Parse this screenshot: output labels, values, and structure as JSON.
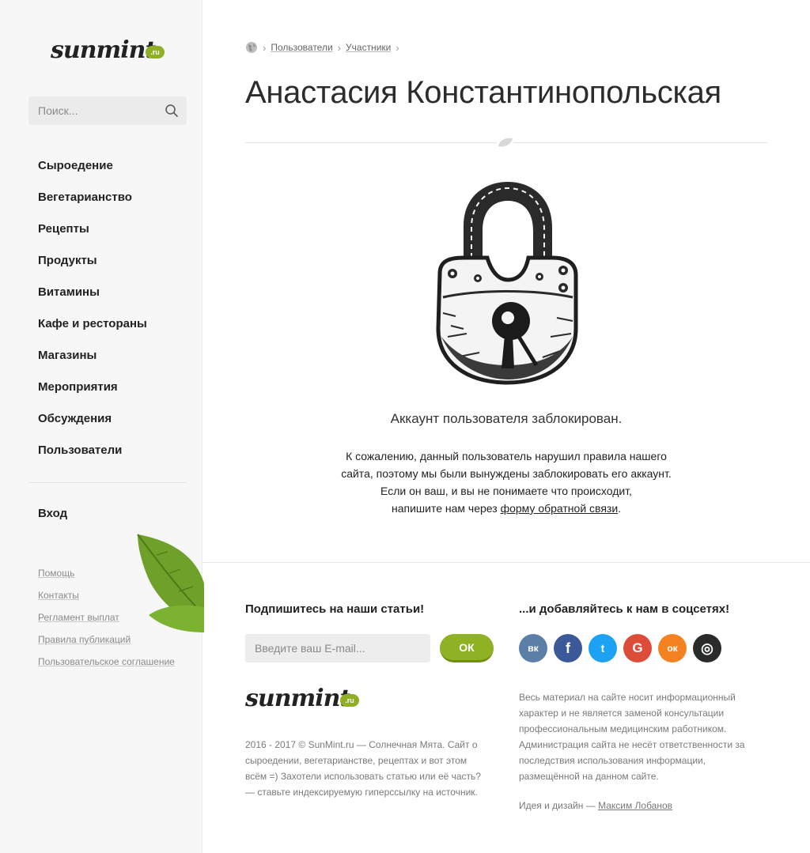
{
  "sidebar": {
    "logo_text": "sunmint",
    "logo_badge": ".ru",
    "search_placeholder": "Поиск...",
    "nav": [
      {
        "label": "Сыроедение"
      },
      {
        "label": "Вегетарианство"
      },
      {
        "label": "Рецепты"
      },
      {
        "label": "Продукты"
      },
      {
        "label": "Витамины"
      },
      {
        "label": "Кафе и рестораны"
      },
      {
        "label": "Магазины"
      },
      {
        "label": "Мероприятия"
      },
      {
        "label": "Обсуждения"
      },
      {
        "label": "Пользователи"
      }
    ],
    "login_label": "Вход",
    "small_links": [
      {
        "label": "Помощь"
      },
      {
        "label": "Контакты"
      },
      {
        "label": "Регламент выплат"
      },
      {
        "label": "Правила публикаций"
      },
      {
        "label": "Пользовательское соглашение"
      }
    ]
  },
  "breadcrumb": {
    "items": [
      {
        "label": "Пользователи"
      },
      {
        "label": "Участники"
      }
    ]
  },
  "page": {
    "title": "Анастасия Константинопольская",
    "blocked_title": "Аккаунт пользователя заблокирован.",
    "blocked_lines": [
      "К сожалению, данный пользователь нарушил правила нашего",
      "сайта, поэтому мы были вынуждены заблокировать его аккаунт.",
      "Если он ваш, и вы не понимаете что происходит,"
    ],
    "blocked_last_prefix": "напишите нам через ",
    "blocked_link": "форму обратной связи",
    "blocked_last_suffix": "."
  },
  "footer": {
    "subscribe_title": "Подпишитесь на наши статьи!",
    "email_placeholder": "Введите ваш E-mail...",
    "ok_label": "ОК",
    "logo_text": "sunmint",
    "logo_badge": ".ru",
    "copyright": "2016 - 2017 © SunMint.ru — Солнечная Мята. Сайт о сыроедении, вегетарианстве, рецептах и вот этом всём =) Захотели использовать статью или её часть? — ставьте индексируемую гиперссылку на источник.",
    "social_title": "...и добавляйтесь к нам в соцсетях!",
    "socials": [
      {
        "name": "vk-icon",
        "glyph": "вк",
        "color": "#5b7fa6"
      },
      {
        "name": "facebook-icon",
        "glyph": "f",
        "color": "#3b5998"
      },
      {
        "name": "twitter-icon",
        "glyph": "t",
        "color": "#1da1f2"
      },
      {
        "name": "google-icon",
        "glyph": "G",
        "color": "#dd4b39"
      },
      {
        "name": "odnoklassniki-icon",
        "glyph": "ок",
        "color": "#f58220"
      },
      {
        "name": "instagram-icon",
        "glyph": "◎",
        "color": "#2b2b2b"
      }
    ],
    "disclaimer": "Весь материал на сайте носит информационный характер и не является заменой консультации профессиональным медицинским работником. Администрация сайта не несёт ответственности за последствия использования информации, размещённой на данном сайте.",
    "credits_prefix": "Идея и дизайн — ",
    "credits_author": "Максим Лобанов"
  },
  "colors": {
    "accent": "#8fb124",
    "text": "#222222",
    "muted": "#7a7a7a"
  }
}
